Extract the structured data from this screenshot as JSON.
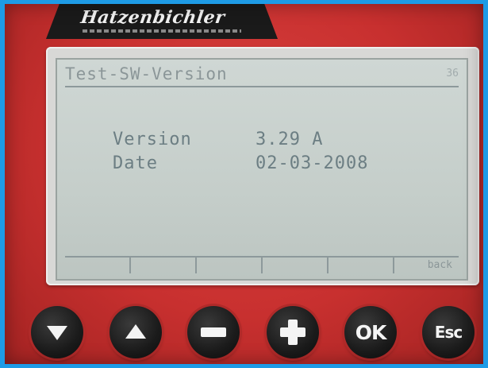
{
  "brand": {
    "logo_text": "Hatzenbichler"
  },
  "screen": {
    "title": "Test-SW-Version",
    "page_indicator": "36",
    "rows": [
      {
        "label": "Version",
        "value": "3.29 A"
      },
      {
        "label": "Date",
        "value": "02-03-2008"
      }
    ],
    "softkeys": [
      "",
      "",
      "",
      "",
      "",
      "back"
    ]
  },
  "keypad": {
    "ok_label": "OK",
    "esc_label": "Esc"
  },
  "colors": {
    "device_red": "#c8302f",
    "lcd_background": "#c8d1cd",
    "lcd_text": "#6c7e83",
    "key_black": "#1b1b1b"
  }
}
